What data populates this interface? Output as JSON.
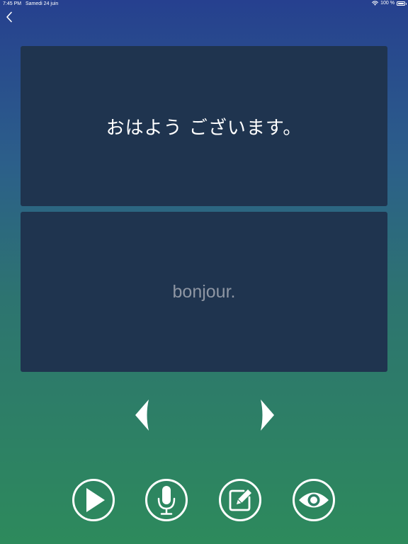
{
  "status_bar": {
    "time": "7:45 PM",
    "date": "Samedi 24 juin",
    "battery": "100 %"
  },
  "navigation": {
    "back_icon": "chevron-left-icon"
  },
  "flashcard": {
    "prompt": "おはよう ございます。",
    "answer": "bonjour."
  },
  "controls": {
    "previous_icon": "caret-left-icon",
    "next_icon": "caret-right-icon",
    "actions": [
      "play-icon",
      "microphone-icon",
      "edit-icon",
      "eye-icon"
    ]
  },
  "colors": {
    "card_background": "#1f344f",
    "answer_text": "#8e96a3",
    "gradient_top": "#26408f",
    "gradient_bottom": "#2d8a5c"
  }
}
